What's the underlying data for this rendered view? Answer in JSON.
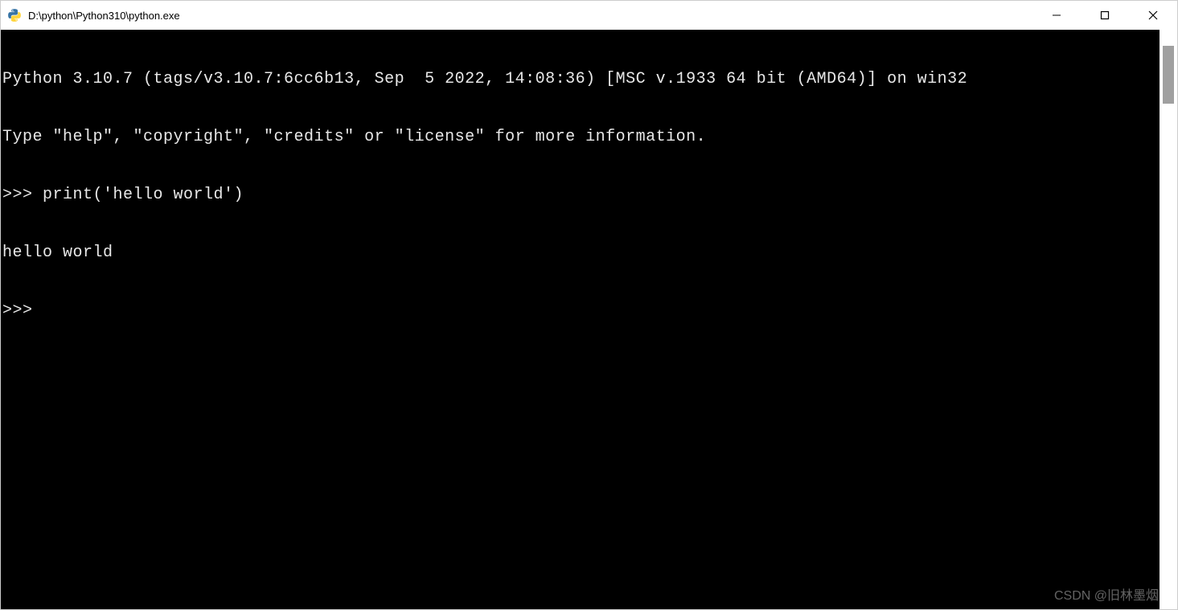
{
  "window": {
    "title": "D:\\python\\Python310\\python.exe"
  },
  "terminal": {
    "lines": [
      "Python 3.10.7 (tags/v3.10.7:6cc6b13, Sep  5 2022, 14:08:36) [MSC v.1933 64 bit (AMD64)] on win32",
      "Type \"help\", \"copyright\", \"credits\" or \"license\" for more information.",
      ">>> print('hello world')",
      "hello world",
      ">>> "
    ]
  },
  "watermark": "CSDN @旧林墨烟"
}
